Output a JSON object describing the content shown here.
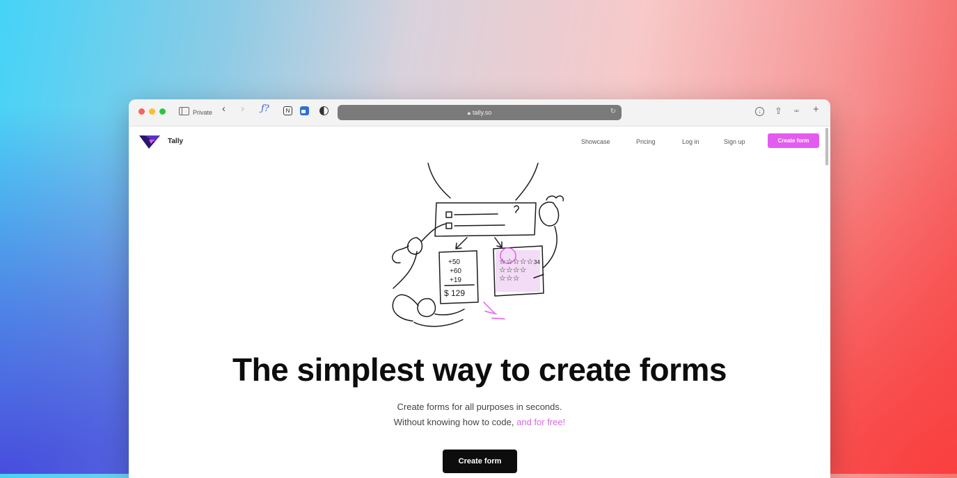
{
  "browser": {
    "private_label": "Private",
    "url": "tally.so",
    "back_glyph": "‹",
    "forward_glyph": "›",
    "extensions": [
      "fx-icon",
      "notion-icon",
      "bitwarden-icon",
      "dark-mode-icon"
    ],
    "ext_f_glyph": "ƒ?",
    "ext_n_glyph": "N"
  },
  "site": {
    "brand": "Tally",
    "nav": {
      "showcase": "Showcase",
      "pricing": "Pricing",
      "login": "Log in",
      "signup": "Sign up",
      "create_form": "Create form"
    },
    "hero": {
      "headline": "The simplest way to create forms",
      "sub_line1": "Create forms for all purposes in seconds.",
      "sub_line2_prefix": "Without knowing how to code, ",
      "sub_line2_highlight": "and for free!",
      "cta": "Create form"
    },
    "illustration": {
      "sum_lines": [
        "+50",
        "+60",
        "+19"
      ],
      "total": "$ 129",
      "rating_value": "34"
    }
  },
  "colors": {
    "accent": "#e45bf0",
    "highlight_text": "#d46ae0",
    "cta_dark": "#0d0d0d"
  }
}
